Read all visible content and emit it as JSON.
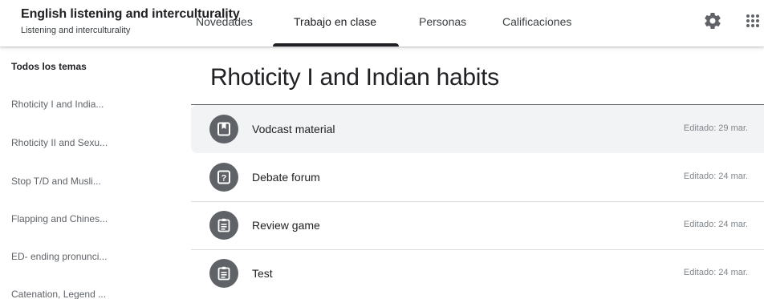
{
  "header": {
    "course_title": "English listening and interculturality",
    "course_subtitle": "Listening and interculturality",
    "tabs": [
      {
        "label": "Novedades"
      },
      {
        "label": "Trabajo en clase"
      },
      {
        "label": "Personas"
      },
      {
        "label": "Calificaciones"
      }
    ],
    "active_tab": "Trabajo en clase",
    "icons": [
      "gear-icon",
      "apps-grid-icon"
    ]
  },
  "sidebar": {
    "topics": [
      {
        "label": "Todos los temas"
      },
      {
        "label": "Rhoticity I and India..."
      },
      {
        "label": "Rhoticity II and Sexu..."
      },
      {
        "label": "Stop T/D and Musli..."
      },
      {
        "label": "Flapping and Chines..."
      },
      {
        "label": "ED- ending pronunci..."
      },
      {
        "label": "Catenation, Legend ..."
      }
    ]
  },
  "main": {
    "section_title": "Rhoticity I and Indian habits",
    "items": [
      {
        "title": "Vodcast material",
        "date": "Editado: 29 mar.",
        "icon": "material-icon"
      },
      {
        "title": "Debate forum",
        "date": "Editado: 24 mar.",
        "icon": "question-icon"
      },
      {
        "title": "Review game",
        "date": "Editado: 24 mar.",
        "icon": "assignment-icon"
      },
      {
        "title": "Test",
        "date": "Editado: 24 mar.",
        "icon": "assignment-icon"
      }
    ]
  },
  "colors": {
    "icon_circle": "#5f6368",
    "highlight_row": "#f1f3f4",
    "text_primary": "#202124",
    "text_secondary": "#5f6368"
  }
}
